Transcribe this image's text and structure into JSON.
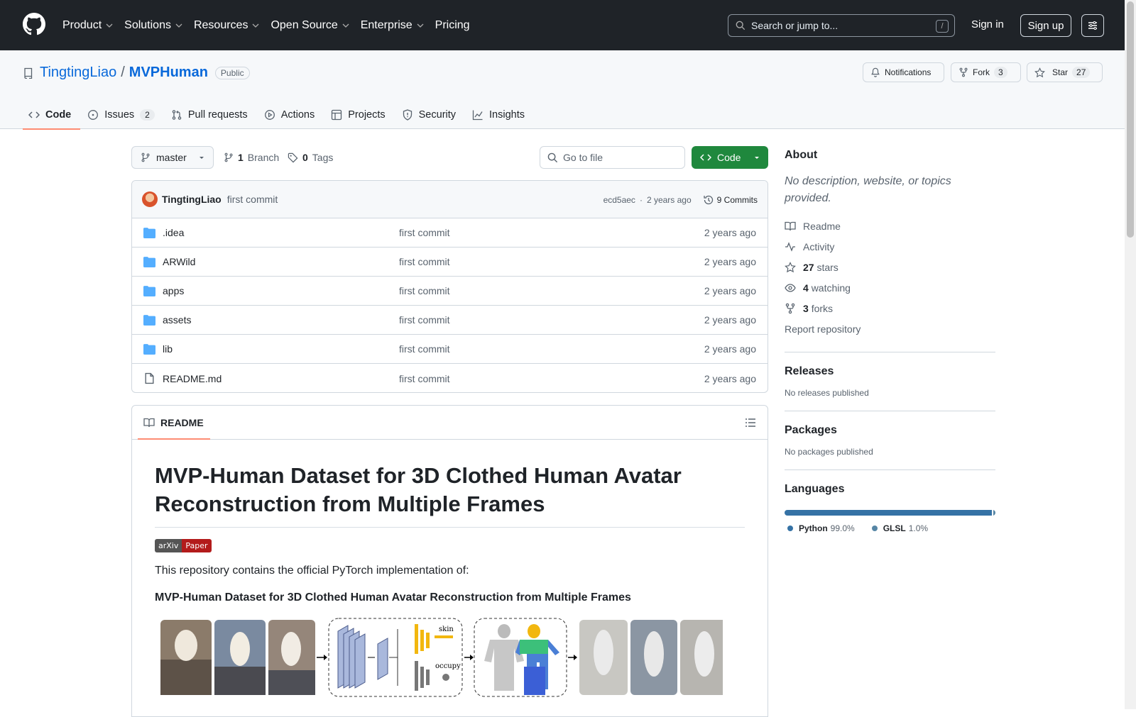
{
  "nav": {
    "items": [
      "Product",
      "Solutions",
      "Resources",
      "Open Source",
      "Enterprise",
      "Pricing"
    ],
    "search_placeholder": "Search or jump to...",
    "search_shortcut": "/",
    "sign_in": "Sign in",
    "sign_up": "Sign up"
  },
  "repo": {
    "owner": "TingtingLiao",
    "separator": "/",
    "name": "MVPHuman",
    "visibility": "Public",
    "notifications": "Notifications",
    "fork_label": "Fork",
    "fork_count": "3",
    "star_label": "Star",
    "star_count": "27"
  },
  "tabs": [
    {
      "label": "Code",
      "icon": "code-icon"
    },
    {
      "label": "Issues",
      "count": "2",
      "icon": "issue-icon"
    },
    {
      "label": "Pull requests",
      "icon": "pull-request-icon"
    },
    {
      "label": "Actions",
      "icon": "play-icon"
    },
    {
      "label": "Projects",
      "icon": "table-icon"
    },
    {
      "label": "Security",
      "icon": "shield-icon"
    },
    {
      "label": "Insights",
      "icon": "graph-icon"
    }
  ],
  "toolbar": {
    "branch": "master",
    "branch_count": "1",
    "branch_label": "Branch",
    "tag_count": "0",
    "tag_label": "Tags",
    "goto_placeholder": "Go to file",
    "code_button": "Code"
  },
  "commit": {
    "author": "TingtingLiao",
    "message": "first commit",
    "hash": "ecd5aec",
    "dot": "·",
    "time": "2 years ago",
    "commits": "9 Commits"
  },
  "files": [
    {
      "name": ".idea",
      "type": "dir",
      "message": "first commit",
      "date": "2 years ago"
    },
    {
      "name": "ARWild",
      "type": "dir",
      "message": "first commit",
      "date": "2 years ago"
    },
    {
      "name": "apps",
      "type": "dir",
      "message": "first commit",
      "date": "2 years ago"
    },
    {
      "name": "assets",
      "type": "dir",
      "message": "first commit",
      "date": "2 years ago"
    },
    {
      "name": "lib",
      "type": "dir",
      "message": "first commit",
      "date": "2 years ago"
    },
    {
      "name": "README.md",
      "type": "file",
      "message": "first commit",
      "date": "2 years ago"
    }
  ],
  "readme": {
    "tab": "README",
    "title": "MVP-Human Dataset for 3D Clothed Human Avatar Reconstruction from Multiple Frames",
    "badge_left": "arXiv",
    "badge_right": "Paper",
    "intro": "This repository contains the official PyTorch implementation of:",
    "bold_title": "MVP-Human Dataset for 3D Clothed Human Avatar Reconstruction from Multiple Frames",
    "figure_label_skin": "skin",
    "figure_label_occupy": "occupy"
  },
  "about": {
    "title": "About",
    "description": "No description, website, or topics provided.",
    "readme": "Readme",
    "activity": "Activity",
    "stars_count": "27",
    "stars_label": "stars",
    "watching_count": "4",
    "watching_label": "watching",
    "forks_count": "3",
    "forks_label": "forks",
    "report": "Report repository"
  },
  "releases": {
    "title": "Releases",
    "text": "No releases published"
  },
  "packages": {
    "title": "Packages",
    "text": "No packages published"
  },
  "languages": {
    "title": "Languages",
    "items": [
      {
        "name": "Python",
        "percent": "99.0%",
        "value": 99.0,
        "color": "#3572A5"
      },
      {
        "name": "GLSL",
        "percent": "1.0%",
        "value": 1.0,
        "color": "#5686a5"
      }
    ]
  }
}
